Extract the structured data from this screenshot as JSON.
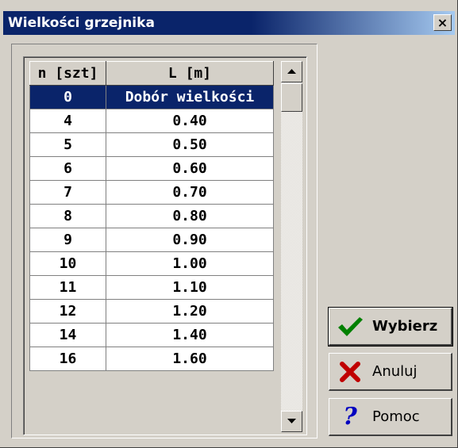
{
  "window": {
    "title": "Wielkości grzejnika",
    "close_label": "×"
  },
  "grid": {
    "headers": [
      "n [szt]",
      "L [m]"
    ],
    "rows": [
      {
        "n": "0",
        "l": "Dobór wielkości",
        "selected": true
      },
      {
        "n": "4",
        "l": "0.40"
      },
      {
        "n": "5",
        "l": "0.50"
      },
      {
        "n": "6",
        "l": "0.60"
      },
      {
        "n": "7",
        "l": "0.70"
      },
      {
        "n": "8",
        "l": "0.80"
      },
      {
        "n": "9",
        "l": "0.90"
      },
      {
        "n": "10",
        "l": "1.00"
      },
      {
        "n": "11",
        "l": "1.10"
      },
      {
        "n": "12",
        "l": "1.20"
      },
      {
        "n": "14",
        "l": "1.40"
      },
      {
        "n": "16",
        "l": "1.60"
      }
    ]
  },
  "buttons": {
    "select_label": "Wybierz",
    "cancel_label": "Anuluj",
    "help_label": "Pomoc",
    "select_icon": "checkmark-icon",
    "cancel_icon": "x-icon",
    "help_icon": "question-icon"
  },
  "colors": {
    "titlebar": "#0a246a",
    "selection": "#0a246a",
    "check": "#008000",
    "cross": "#c00000",
    "question": "#0000c0"
  }
}
